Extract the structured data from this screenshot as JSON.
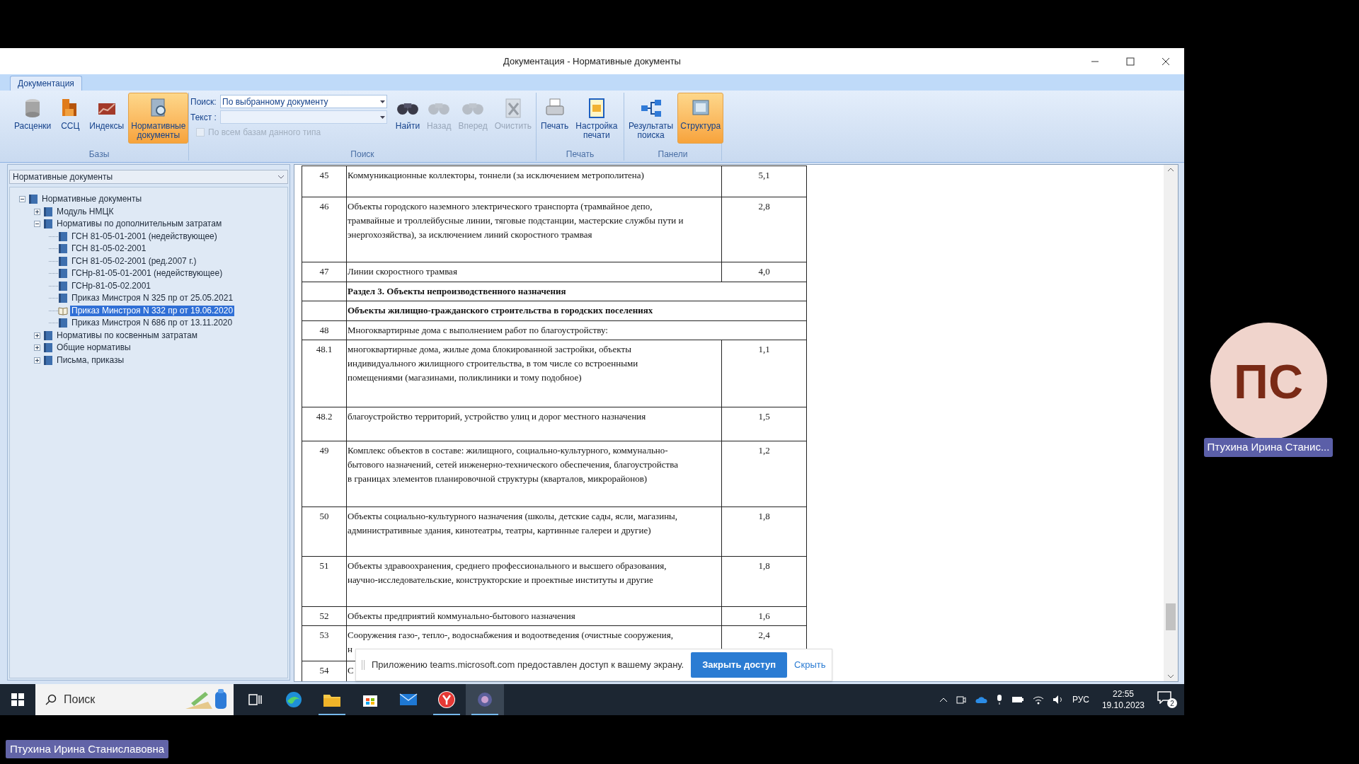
{
  "window": {
    "title": "Документация - Нормативные документы"
  },
  "ribbon": {
    "tabs": [
      {
        "label": "Документация",
        "selected": true
      }
    ],
    "groups": [
      {
        "label": "Базы",
        "buttons": [
          {
            "label": "Расценки",
            "selected": false,
            "disabled": false
          },
          {
            "label": "ССЦ",
            "selected": false,
            "disabled": false
          },
          {
            "label": "Индексы",
            "selected": false,
            "disabled": false
          },
          {
            "label": "Нормативные документы",
            "selected": true,
            "disabled": false
          }
        ]
      },
      {
        "label": "Поиск",
        "search_field": {
          "label": "Поиск:",
          "value": "По выбранному документу"
        },
        "text_field": {
          "label": "Текст :"
        },
        "checkbox": {
          "label": "По всем базам данного типа",
          "checked": false,
          "disabled": true
        },
        "buttons": [
          {
            "label": "Найти",
            "selected": false,
            "disabled": false
          },
          {
            "label": "Назад",
            "selected": false,
            "disabled": true
          },
          {
            "label": "Вперед",
            "selected": false,
            "disabled": true
          },
          {
            "label": "Очистить",
            "selected": false,
            "disabled": true
          }
        ]
      },
      {
        "label": "Печать",
        "buttons": [
          {
            "label": "Печать",
            "selected": false,
            "disabled": false
          },
          {
            "label": "Настройка печати",
            "selected": false,
            "disabled": false
          }
        ]
      },
      {
        "label": "Панели",
        "buttons": [
          {
            "label": "Результаты поиска",
            "selected": false,
            "disabled": false
          },
          {
            "label": "Структура",
            "selected": true,
            "disabled": false
          }
        ]
      }
    ]
  },
  "sidebar": {
    "selector": {
      "value": "Нормативные документы"
    },
    "tree": [
      {
        "label": "Нормативные документы",
        "selected": false,
        "expanded": true,
        "children": [
          {
            "label": "Модуль НМЦК",
            "selected": false,
            "expanded": false
          },
          {
            "label": "Нормативы по дополнительным затратам",
            "selected": false,
            "expanded": true,
            "children": [
              {
                "label": "ГСН 81-05-01-2001 (недействующее)",
                "selected": false
              },
              {
                "label": "ГСН 81-05-02-2001",
                "selected": false
              },
              {
                "label": "ГСН 81-05-02-2001 (ред.2007 г.)",
                "selected": false
              },
              {
                "label": "ГСНр-81-05-01-2001 (недействующее)",
                "selected": false
              },
              {
                "label": "ГСНр-81-05-02.2001",
                "selected": false
              },
              {
                "label": "Приказ Минстроя N 325 пр от 25.05.2021",
                "selected": false
              },
              {
                "label": "Приказ Минстроя N 332 пр от 19.06.2020",
                "selected": true
              },
              {
                "label": "Приказ Минстроя N 686 пр от 13.11.2020",
                "selected": false
              }
            ]
          },
          {
            "label": "Нормативы по косвенным затратам",
            "selected": false,
            "expanded": false
          },
          {
            "label": "Общие нормативы",
            "selected": false,
            "expanded": false
          },
          {
            "label": "Письма, приказы",
            "selected": false,
            "expanded": false
          }
        ]
      }
    ]
  },
  "document": {
    "rows": [
      {
        "kind": "item",
        "number": "45",
        "lines": [
          "Коммуникационные коллекторы, тоннели (за исключением метрополитена)"
        ],
        "value": "5,1"
      },
      {
        "kind": "item",
        "number": "46",
        "lines": [
          "Объекты городского наземного электрического транспорта (трамвайное депо,",
          "трамвайные и троллейбусные линии, тяговые подстанции, мастерские службы пути и",
          "энергохозяйства), за исключением линий скоростного трамвая"
        ],
        "value": "2,8"
      },
      {
        "kind": "item",
        "number": "47",
        "lines": [
          "Линии скоростного трамвая"
        ],
        "value": "4,0"
      },
      {
        "kind": "section",
        "lines": [
          "Раздел 3. Объекты непроизводственного назначения"
        ]
      },
      {
        "kind": "section",
        "lines": [
          "Объекты жилищно-гражданского строительства в городских поселениях"
        ]
      },
      {
        "kind": "group",
        "number": "48",
        "lines": [
          "Многоквартирные дома с выполнением работ по благоустройству:"
        ]
      },
      {
        "kind": "item",
        "number": "48.1",
        "lines": [
          "многоквартирные дома, жилые дома блокированной застройки, объекты",
          "индивидуального жилищного строительства, в том числе со встроенными",
          "помещениями (магазинами, поликлиники и тому подобное)"
        ],
        "value": "1,1"
      },
      {
        "kind": "item",
        "number": "48.2",
        "lines": [
          "благоустройство территорий, устройство улиц и дорог местного назначения"
        ],
        "value": "1,5"
      },
      {
        "kind": "item",
        "number": "49",
        "lines": [
          "Комплекс объектов в составе: жилищного, социально-культурного, коммунально-",
          "бытового назначений, сетей инженерно-технического обеспечения, благоустройства",
          "в границах элементов планировочной структуры (кварталов, микрорайонов)"
        ],
        "value": "1,2"
      },
      {
        "kind": "item",
        "number": "50",
        "lines": [
          "Объекты социально-культурного назначения (школы, детские сады, ясли, магазины,",
          "административные здания, кинотеатры, театры, картинные галереи и другие)"
        ],
        "value": "1,8"
      },
      {
        "kind": "item",
        "number": "51",
        "lines": [
          "Объекты здравоохранения, среднего профессионального и высшего образования,",
          "научно-исследовательские, конструкторские и проектные институты и другие"
        ],
        "value": "1,8"
      },
      {
        "kind": "item",
        "number": "52",
        "lines": [
          "Объекты предприятий коммунально-бытового назначения"
        ],
        "value": "1,6"
      },
      {
        "kind": "item",
        "number": "53",
        "lines": [
          "Сооружения газо-, тепло-, водоснабжения и водоотведения (очистные сооружения,",
          "н"
        ],
        "value": "2,4"
      },
      {
        "kind": "item",
        "number": "54",
        "lines": [
          "С"
        ]
      }
    ]
  },
  "share_banner": {
    "text": "Приложению teams.microsoft.com предоставлен доступ к вашему экрану.",
    "button": "Закрыть доступ",
    "link": "Скрыть"
  },
  "taskbar": {
    "search_placeholder": "Поиск",
    "apps": [
      {
        "running": false,
        "selected": false
      },
      {
        "running": false,
        "selected": false
      },
      {
        "running": true,
        "selected": false
      },
      {
        "running": false,
        "selected": false
      },
      {
        "running": false,
        "selected": false
      },
      {
        "running": true,
        "selected": false
      },
      {
        "running": true,
        "selected": true
      }
    ],
    "language": "РУС",
    "time": "22:55",
    "date": "19.10.2023",
    "notifications": "2"
  },
  "participant": {
    "initials": "ПС",
    "name": "Птухина Ирина Станис..."
  },
  "presenter": {
    "name": "Птухина Ирина Станиславовна"
  }
}
